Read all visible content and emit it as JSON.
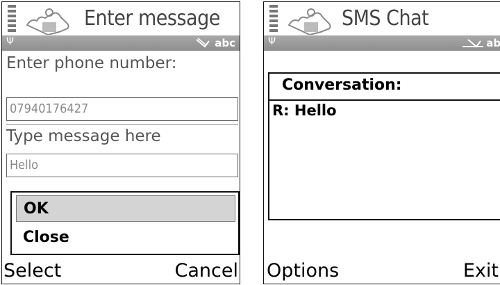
{
  "left_screen": {
    "title": "Enter message",
    "input_mode": "abc",
    "phone_label": "Enter phone number:",
    "phone_value": "07940176427",
    "message_label": "Type message here",
    "message_value": "Hello",
    "menu": {
      "items": [
        "OK",
        "Close"
      ],
      "selected": "OK"
    },
    "softkeys": {
      "left": "Select",
      "right": "Cancel"
    }
  },
  "right_screen": {
    "title": "SMS Chat",
    "input_mode": "abc",
    "conversation_header": "Conversation:",
    "messages": [
      "R: Hello"
    ],
    "softkeys": {
      "left": "Options",
      "right": "Exit"
    }
  },
  "colors": {
    "status_bar": "#9a9a9a",
    "menu_highlight": "#d4d4d4",
    "title_text": "#444444"
  },
  "icons": [
    "signal-strength-icon",
    "app-puzzle-icon",
    "antenna-icon",
    "edit-pen-icon"
  ]
}
